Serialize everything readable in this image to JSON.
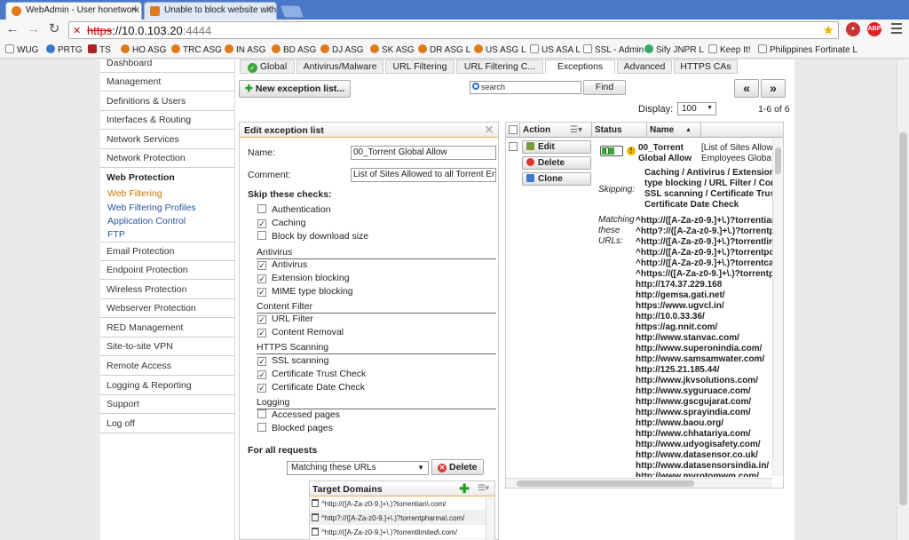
{
  "browser": {
    "tabs": [
      {
        "title": "WebAdmin - User honetwork"
      },
      {
        "title": "Unable to block website with"
      }
    ],
    "url": {
      "scheme": "https",
      "host": "://10.0.103.20",
      "port": ":4444"
    },
    "bookmarks": [
      "WUG",
      "PRTG",
      "TS",
      "HO ASG",
      "TRC ASG",
      "IN ASG",
      "BD ASG",
      "DJ ASG",
      "SK ASG",
      "DR ASG L",
      "US ASG L",
      "US ASA L",
      "SSL - Admin",
      "Sify JNPR L",
      "Keep It!",
      "Philippines Fortinate L"
    ]
  },
  "sidebar": {
    "items": [
      "Dashboard",
      "Management",
      "Definitions & Users",
      "Interfaces & Routing",
      "Network Services",
      "Network Protection",
      "Web Protection"
    ],
    "subitems": [
      "Web Filtering",
      "Web Filtering Profiles",
      "Application Control",
      "FTP"
    ],
    "items_after": [
      "Email Protection",
      "Endpoint Protection",
      "Wireless Protection",
      "Webserver Protection",
      "RED Management",
      "Site-to-site VPN",
      "Remote Access",
      "Logging & Reporting",
      "Support",
      "Log off"
    ]
  },
  "page_tabs": [
    "Global",
    "Antivirus/Malware",
    "URL Filtering",
    "URL Filtering C...",
    "Exceptions",
    "Advanced",
    "HTTPS CAs"
  ],
  "toolbar": {
    "new_button": "New exception list...",
    "search_placeholder": "search",
    "find_button": "Find",
    "display_label": "Display:",
    "display_value": "100",
    "page_count": "1-6 of 6",
    "prev": "«",
    "next": "»"
  },
  "edit": {
    "title": "Edit exception list",
    "name_label": "Name:",
    "name_value": "00_Torrent Global Allow",
    "comment_label": "Comment:",
    "comment_value": "List of Sites Allowed to all Torrent Err",
    "skip_label": "Skip these checks:",
    "checks_top": [
      {
        "label": "Authentication",
        "checked": false
      },
      {
        "label": "Caching",
        "checked": true
      },
      {
        "label": "Block by download size",
        "checked": false
      }
    ],
    "group_antivirus": "Antivirus",
    "checks_antivirus": [
      {
        "label": "Antivirus",
        "checked": true
      },
      {
        "label": "Extension blocking",
        "checked": true
      },
      {
        "label": "MIME type blocking",
        "checked": true
      }
    ],
    "group_content": "Content Filter",
    "checks_content": [
      {
        "label": "URL Filter",
        "checked": true
      },
      {
        "label": "Content Removal",
        "checked": true
      }
    ],
    "group_https": "HTTPS Scanning",
    "checks_https": [
      {
        "label": "SSL scanning",
        "checked": true
      },
      {
        "label": "Certificate Trust Check",
        "checked": true
      },
      {
        "label": "Certificate Date Check",
        "checked": true
      }
    ],
    "group_logging": "Logging",
    "checks_logging": [
      {
        "label": "Accessed pages",
        "checked": false
      },
      {
        "label": "Blocked pages",
        "checked": false
      }
    ],
    "for_all": "For all requests",
    "match_select": "Matching these URLs",
    "delete_button": "Delete",
    "target_title": "Target Domains",
    "targets": [
      "^http://([A-Za-z0-9.]+\\.)?torrentian\\.com/",
      "^http?://([A-Za-z0-9.]+\\.)?torrentpharma\\.com/",
      "^http://([A-Za-z0-9.]+\\.)?torrentlimited\\.com/"
    ]
  },
  "list": {
    "columns": [
      "Action",
      "Status",
      "Name"
    ],
    "actions": [
      "Edit",
      "Delete",
      "Clone"
    ],
    "row": {
      "name_line1": "00_Torrent",
      "name_line2": "Global Allow",
      "comment_line1": "[List of Sites Allow",
      "comment_line2": "Employees Globa",
      "skipping_label": "Skipping:",
      "skipping_lines": [
        "Caching / Antivirus / Extension b",
        "type blocking / URL Filter / Conte",
        "SSL scanning / Certificate Trust",
        "Certificate Date Check"
      ],
      "matching_label_lines": [
        "Matching",
        "these",
        "URLs:"
      ],
      "urls": [
        "^http://([A-Za-z0-9.]+\\.)?torrentian\\.co",
        "^http?://([A-Za-z0-9.]+\\.)?torrentpharr",
        "^http://([A-Za-z0-9.]+\\.)?torrentlimited",
        "^http://([A-Za-z0-9.]+\\.)?torrentpower",
        "^http://([A-Za-z0-9.]+\\.)?torrentcables",
        "^https://([A-Za-z0-9.]+\\.)?torrentpharr",
        "http://174.37.229.168",
        "http://gemsa.gati.net/",
        "https://www.ugvcl.in/",
        "http://10.0.33.36/",
        "https://ag.nnit.com/",
        "http://www.stanvac.com/",
        "http://www.superonindia.com/",
        "http://www.samsamwater.com/",
        "http://125.21.185.44/",
        "http://www.jkvsolutions.com/",
        "http://www.syguruace.com/",
        "http://www.gscgujarat.com/",
        "http://www.sprayindia.com/",
        "http://www.baou.org/",
        "http://www.chhatariya.com/",
        "http://www.udyogisafety.com/",
        "http://www.datasensor.co.uk/",
        "http://www.datasensorsindia.in/",
        "http://www.mvrotomwm.com/"
      ]
    }
  },
  "colors": {
    "accent": "#e8b040",
    "tabbar": "#4a78c8",
    "link": "#2a55a0",
    "current": "#c87400"
  }
}
